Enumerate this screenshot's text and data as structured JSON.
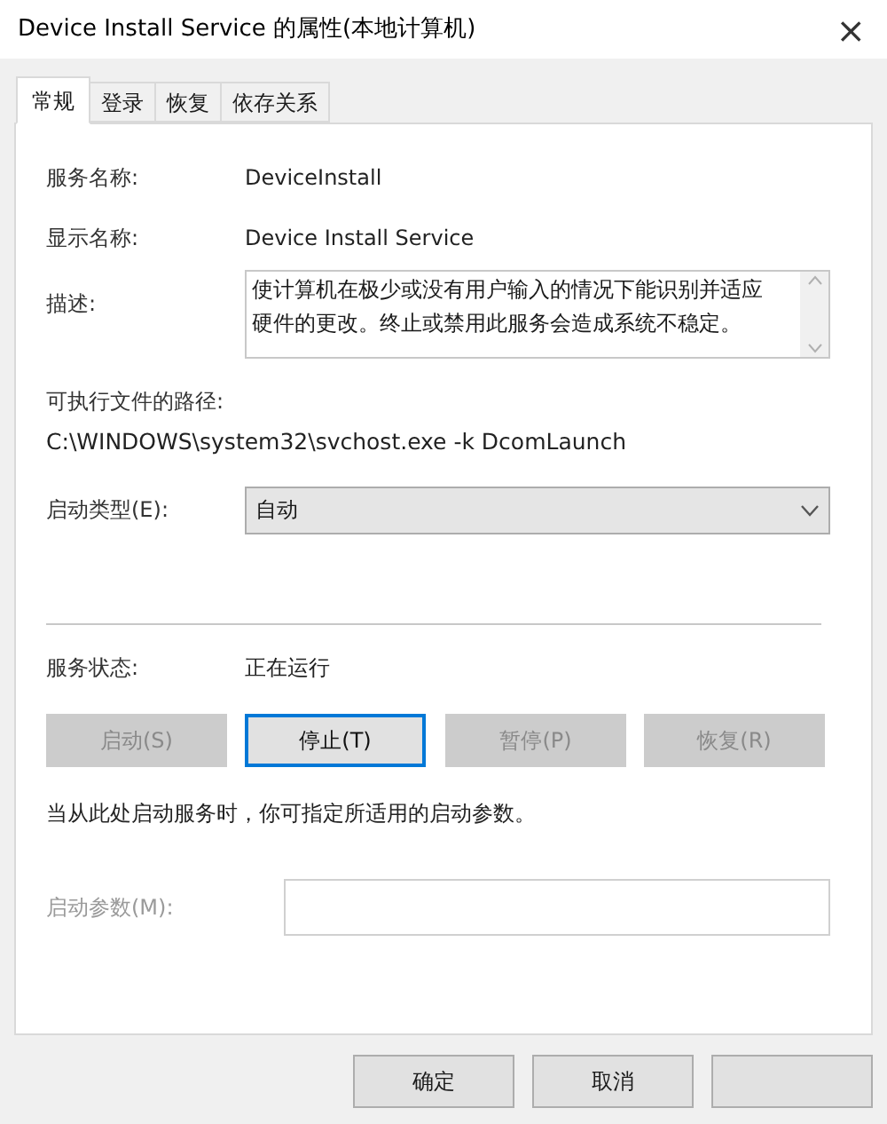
{
  "window": {
    "title": "Device Install Service 的属性(本地计算机)",
    "close": "×"
  },
  "tabs": [
    {
      "label": "常规",
      "selected": true
    },
    {
      "label": "登录",
      "selected": false
    },
    {
      "label": "恢复",
      "selected": false
    },
    {
      "label": "依存关系",
      "selected": false
    }
  ],
  "service_name": {
    "label": "服务名称:",
    "value": "DeviceInstall"
  },
  "display_name": {
    "label": "显示名称:",
    "value": "Device Install Service"
  },
  "description": {
    "label": "描述:",
    "value": "使计算机在极少或没有用户输入的情况下能识别并适应硬件的更改。终止或禁用此服务会造成系统不稳定。"
  },
  "executable_path": {
    "label": "可执行文件的路径:",
    "value": "C:\\WINDOWS\\system32\\svchost.exe -k DcomLaunch"
  },
  "startup_type": {
    "label": "启动类型(E):",
    "value": "自动"
  },
  "service_status": {
    "label": "服务状态:",
    "value": "正在运行"
  },
  "service_buttons": [
    {
      "label": "启动(S)",
      "disabled": true,
      "focused": false
    },
    {
      "label": "停止(T)",
      "disabled": false,
      "focused": true
    },
    {
      "label": "暂停(P)",
      "disabled": true,
      "focused": false
    },
    {
      "label": "恢复(R)",
      "disabled": true,
      "focused": false
    }
  ],
  "hint": "当从此处启动服务时，你可指定所适用的启动参数。",
  "start_parameters": {
    "label": "启动参数(M):",
    "disabled": true
  },
  "dialog_buttons": [
    {
      "kind": "text",
      "label": "确定"
    },
    {
      "kind": "text",
      "label": "取消"
    },
    {
      "kind": "blank"
    }
  ]
}
